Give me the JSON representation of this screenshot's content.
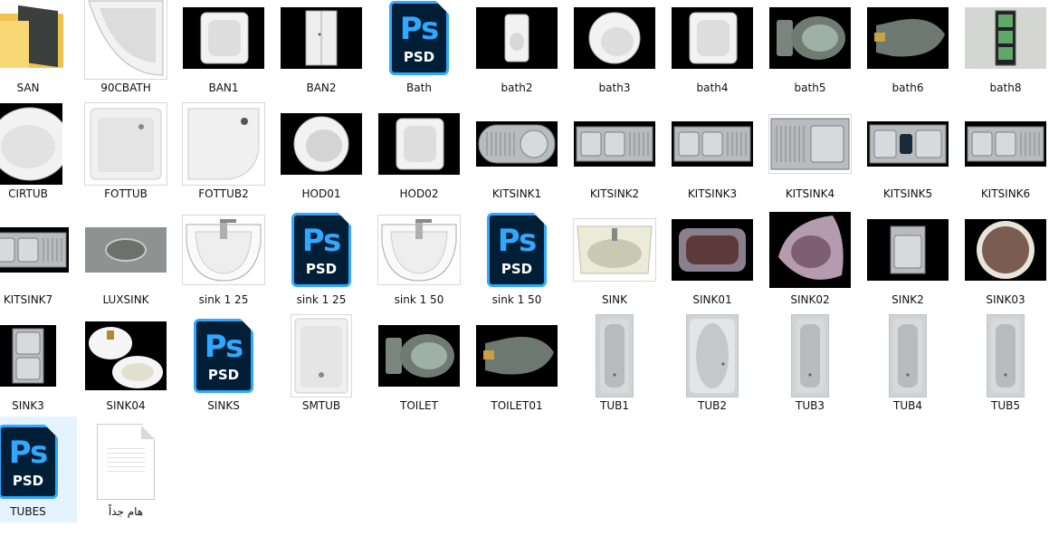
{
  "files": [
    {
      "name": "SAN",
      "kind": "folder"
    },
    {
      "name": "90CBATH",
      "kind": "photo",
      "shape": "corner-bath"
    },
    {
      "name": "BAN1",
      "kind": "photo",
      "shape": "square-basin"
    },
    {
      "name": "BAN2",
      "kind": "photo",
      "shape": "door"
    },
    {
      "name": "Bath",
      "kind": "psd"
    },
    {
      "name": "bath2",
      "kind": "photo",
      "shape": "small-sink"
    },
    {
      "name": "bath3",
      "kind": "photo",
      "shape": "round-sink"
    },
    {
      "name": "bath4",
      "kind": "photo",
      "shape": "square-basin"
    },
    {
      "name": "bath5",
      "kind": "photo",
      "shape": "toilet-top"
    },
    {
      "name": "bath6",
      "kind": "photo",
      "shape": "toilet-side"
    },
    {
      "name": "bath8",
      "kind": "photo",
      "shape": "panel"
    },
    {
      "name": "CIRTUB",
      "kind": "photo",
      "shape": "round-tub"
    },
    {
      "name": "FOTTUB",
      "kind": "photo",
      "shape": "shower-tray"
    },
    {
      "name": "FOTTUB2",
      "kind": "photo",
      "shape": "shower-tray-round"
    },
    {
      "name": "HOD01",
      "kind": "photo",
      "shape": "oval-basin"
    },
    {
      "name": "HOD02",
      "kind": "photo",
      "shape": "square-basin"
    },
    {
      "name": "KITSINK1",
      "kind": "photo",
      "shape": "kitchen-round"
    },
    {
      "name": "KITSINK2",
      "kind": "photo",
      "shape": "kitchen-double"
    },
    {
      "name": "KITSINK3",
      "kind": "photo",
      "shape": "kitchen-double"
    },
    {
      "name": "KITSINK4",
      "kind": "photo",
      "shape": "kitchen-single"
    },
    {
      "name": "KITSINK5",
      "kind": "photo",
      "shape": "kitchen-triple"
    },
    {
      "name": "KITSINK6",
      "kind": "photo",
      "shape": "kitchen-double"
    },
    {
      "name": "KITSINK7",
      "kind": "photo",
      "shape": "kitchen-double"
    },
    {
      "name": "LUXSINK",
      "kind": "photo",
      "shape": "marble-sink"
    },
    {
      "name": "sink 1 25",
      "kind": "photo",
      "shape": "washbasin"
    },
    {
      "name": "sink 1 25",
      "kind": "psd"
    },
    {
      "name": "sink 1 50",
      "kind": "photo",
      "shape": "washbasin"
    },
    {
      "name": "sink 1 50",
      "kind": "psd"
    },
    {
      "name": "SINK",
      "kind": "photo",
      "shape": "cream-basin"
    },
    {
      "name": "SINK01",
      "kind": "photo",
      "shape": "stone-basin"
    },
    {
      "name": "SINK02",
      "kind": "photo",
      "shape": "stone-oval"
    },
    {
      "name": "SINK2",
      "kind": "photo",
      "shape": "steel-square"
    },
    {
      "name": "SINK03",
      "kind": "photo",
      "shape": "stone-round"
    },
    {
      "name": "SINK3",
      "kind": "photo",
      "shape": "steel-double"
    },
    {
      "name": "SINK04",
      "kind": "photo",
      "shape": "two-basins"
    },
    {
      "name": "SINKS",
      "kind": "psd"
    },
    {
      "name": "SMTUB",
      "kind": "photo",
      "shape": "small-tub"
    },
    {
      "name": "TOILET",
      "kind": "photo",
      "shape": "toilet-top"
    },
    {
      "name": "TOILET01",
      "kind": "photo",
      "shape": "toilet-side"
    },
    {
      "name": "TUB1",
      "kind": "photo",
      "shape": "tub"
    },
    {
      "name": "TUB2",
      "kind": "photo",
      "shape": "tub-oval"
    },
    {
      "name": "TUB3",
      "kind": "photo",
      "shape": "tub"
    },
    {
      "name": "TUB4",
      "kind": "photo",
      "shape": "tub"
    },
    {
      "name": "TUB5",
      "kind": "photo",
      "shape": "tub"
    },
    {
      "name": "TUBES",
      "kind": "psd",
      "selected": true
    },
    {
      "name": "هام جداً",
      "kind": "document",
      "rtl": true
    }
  ],
  "psd_icon": {
    "letters": "Ps",
    "ext": "PSD"
  },
  "colors": {
    "selection": "#e5f3ff",
    "ps_blue": "#31a8ff",
    "ps_dark": "#001e36"
  }
}
